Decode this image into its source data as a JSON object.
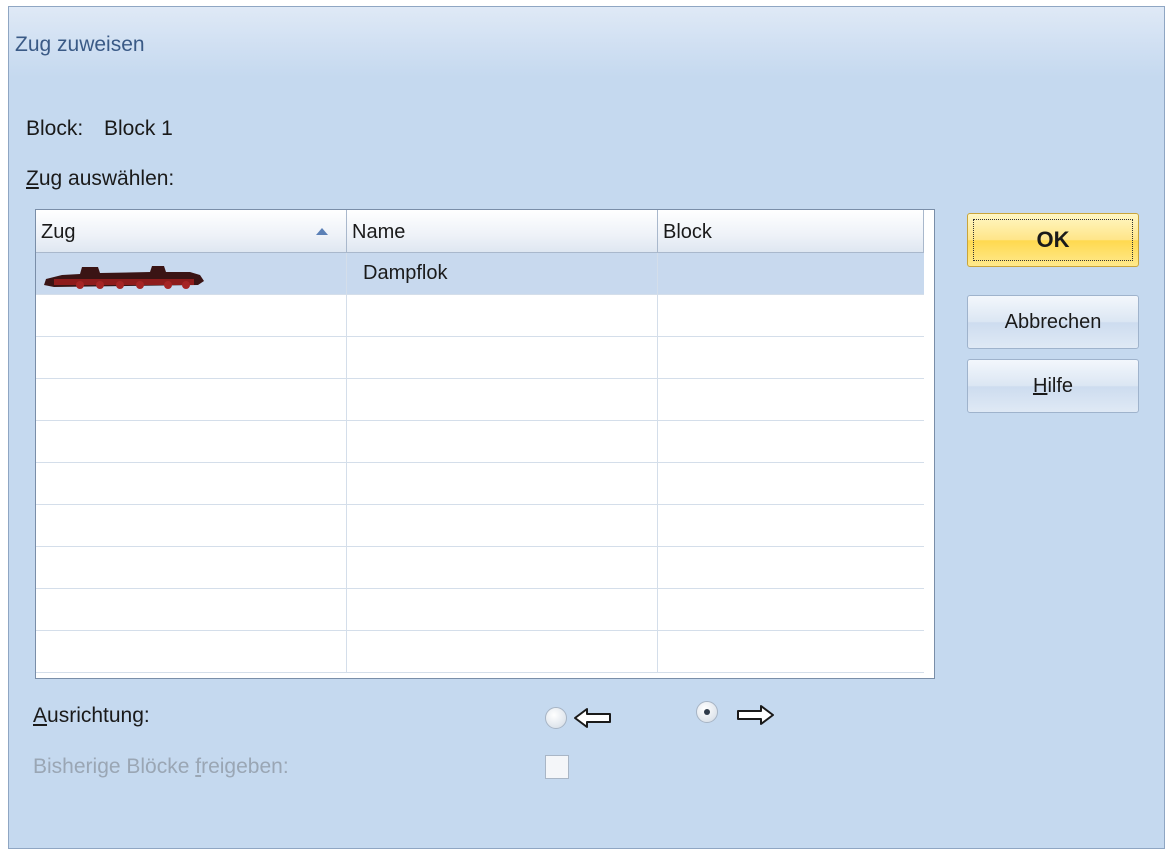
{
  "window": {
    "title": "Zug zuweisen"
  },
  "block": {
    "label": "Block:",
    "value": "Block 1"
  },
  "select_label": {
    "underlined": "Z",
    "rest": "ug auswählen:"
  },
  "table": {
    "columns": [
      "Zug",
      "Name",
      "Block"
    ],
    "sort_column": "Zug",
    "sort_direction": "ascending",
    "rows": [
      {
        "zug_icon": "steam-locomotive-icon",
        "name": "Dampflok",
        "block": "",
        "selected": true
      }
    ],
    "empty_rows": 9
  },
  "buttons": {
    "ok": "OK",
    "cancel": "Abbrechen",
    "help": {
      "underlined": "H",
      "rest": "ilfe"
    }
  },
  "orientation": {
    "label": {
      "underlined": "A",
      "rest": "usrichtung:"
    },
    "options": [
      {
        "icon": "arrow-left-icon",
        "selected": false
      },
      {
        "icon": "arrow-right-icon",
        "selected": true
      }
    ]
  },
  "release_blocks": {
    "label": {
      "before": "Bisherige Blöcke ",
      "underlined": "f",
      "after": "reigeben:"
    },
    "checked": false,
    "enabled": false
  },
  "colors": {
    "dialog_bg": "#c5d9ef",
    "selection": "#c8d9ee",
    "ok_button": "#ffd94f",
    "title_text": "#3a5a86"
  }
}
